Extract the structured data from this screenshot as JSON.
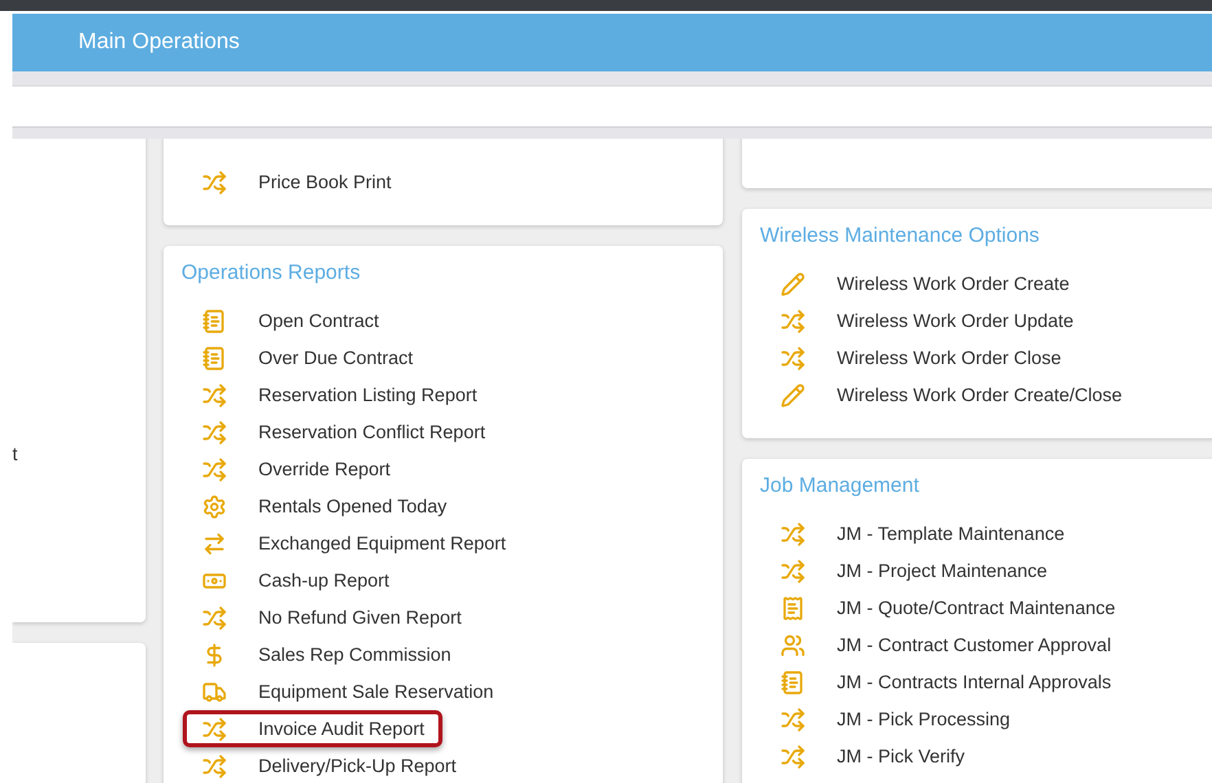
{
  "header": {
    "title": "Main Operations"
  },
  "left_column": {
    "texts": [
      "t"
    ]
  },
  "middle_column": [
    {
      "items": [
        {
          "label": "Price Book Print",
          "kind": "shuffle",
          "highlighted": false
        }
      ]
    },
    {
      "title": "Operations Reports",
      "items": [
        {
          "label": "Open Contract",
          "kind": "notebook",
          "highlighted": false
        },
        {
          "label": "Over Due Contract",
          "kind": "notebook",
          "highlighted": false
        },
        {
          "label": "Reservation Listing Report",
          "kind": "shuffle",
          "highlighted": false
        },
        {
          "label": "Reservation Conflict Report",
          "kind": "shuffle",
          "highlighted": false
        },
        {
          "label": "Override Report",
          "kind": "shuffle",
          "highlighted": false
        },
        {
          "label": "Rentals Opened Today",
          "kind": "gear",
          "highlighted": false
        },
        {
          "label": "Exchanged Equipment Report",
          "kind": "exchange",
          "highlighted": false
        },
        {
          "label": "Cash-up Report",
          "kind": "cash",
          "highlighted": false
        },
        {
          "label": "No Refund Given Report",
          "kind": "shuffle",
          "highlighted": false
        },
        {
          "label": "Sales Rep Commission",
          "kind": "dollar",
          "highlighted": false
        },
        {
          "label": "Equipment Sale Reservation",
          "kind": "truck",
          "highlighted": false
        },
        {
          "label": "Invoice Audit Report",
          "kind": "shuffle",
          "highlighted": true
        },
        {
          "label": "Delivery/Pick-Up Report",
          "kind": "shuffle",
          "highlighted": false
        }
      ]
    }
  ],
  "right_column": [
    {
      "title": "Wireless Maintenance Options",
      "items": [
        {
          "label": "Wireless Work Order Create",
          "kind": "pencil",
          "highlighted": false
        },
        {
          "label": "Wireless Work Order Update",
          "kind": "shuffle",
          "highlighted": false
        },
        {
          "label": "Wireless Work Order Close",
          "kind": "shuffle",
          "highlighted": false
        },
        {
          "label": "Wireless Work Order Create/Close",
          "kind": "pencil",
          "highlighted": false
        }
      ]
    },
    {
      "title": "Job Management",
      "items": [
        {
          "label": "JM - Template Maintenance",
          "kind": "shuffle",
          "highlighted": false
        },
        {
          "label": "JM - Project Maintenance",
          "kind": "shuffle",
          "highlighted": false
        },
        {
          "label": "JM - Quote/Contract Maintenance",
          "kind": "invoice",
          "highlighted": false
        },
        {
          "label": "JM - Contract Customer Approval",
          "kind": "people",
          "highlighted": false
        },
        {
          "label": "JM - Contracts Internal Approvals",
          "kind": "notebook",
          "highlighted": false
        },
        {
          "label": "JM - Pick Processing",
          "kind": "shuffle",
          "highlighted": false
        },
        {
          "label": "JM - Pick Verify",
          "kind": "shuffle",
          "highlighted": false
        }
      ]
    }
  ]
}
